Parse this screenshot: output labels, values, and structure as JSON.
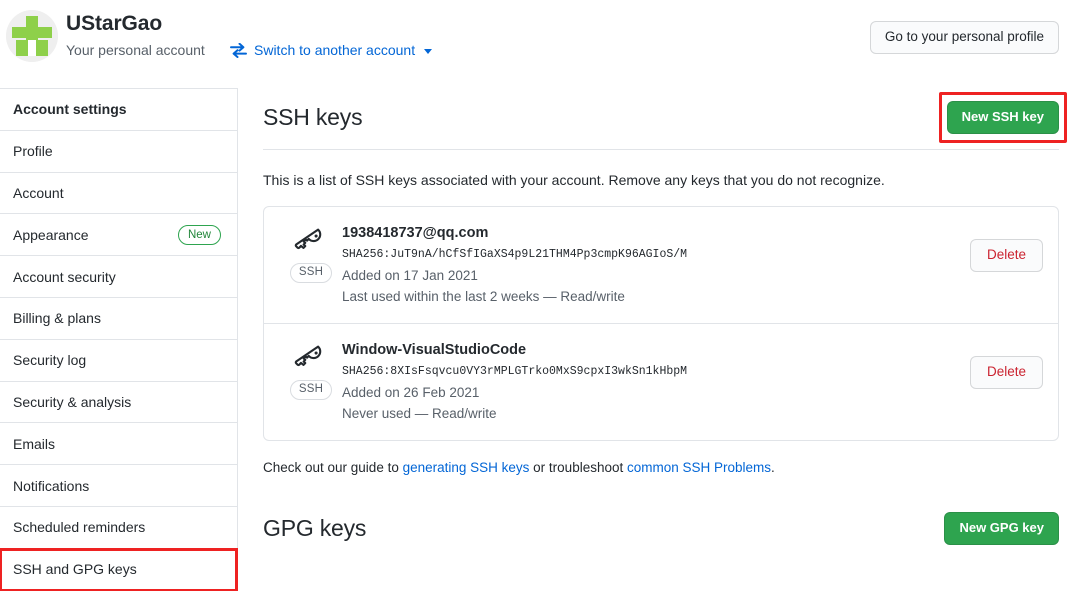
{
  "header": {
    "account_name": "UStarGao",
    "account_subtitle": "Your personal account",
    "switch_label": "Switch to another account",
    "switch_icon": "switch-arrows-icon",
    "personal_profile_button": "Go to your personal profile",
    "avatar_icon": "green-cross-avatar"
  },
  "sidebar": {
    "items": [
      {
        "label": "Account settings",
        "heading": true,
        "badge": "",
        "highlighted": false
      },
      {
        "label": "Profile",
        "heading": false,
        "badge": "",
        "highlighted": false
      },
      {
        "label": "Account",
        "heading": false,
        "badge": "",
        "highlighted": false
      },
      {
        "label": "Appearance",
        "heading": false,
        "badge": "New",
        "highlighted": false
      },
      {
        "label": "Account security",
        "heading": false,
        "badge": "",
        "highlighted": false
      },
      {
        "label": "Billing & plans",
        "heading": false,
        "badge": "",
        "highlighted": false
      },
      {
        "label": "Security log",
        "heading": false,
        "badge": "",
        "highlighted": false
      },
      {
        "label": "Security & analysis",
        "heading": false,
        "badge": "",
        "highlighted": false
      },
      {
        "label": "Emails",
        "heading": false,
        "badge": "",
        "highlighted": false
      },
      {
        "label": "Notifications",
        "heading": false,
        "badge": "",
        "highlighted": false
      },
      {
        "label": "Scheduled reminders",
        "heading": false,
        "badge": "",
        "highlighted": false
      },
      {
        "label": "SSH and GPG keys",
        "heading": false,
        "badge": "",
        "highlighted": true
      }
    ]
  },
  "ssh_section": {
    "title": "SSH keys",
    "new_key_button": "New SSH key",
    "new_key_highlighted": true,
    "description": "This is a list of SSH keys associated with your account. Remove any keys that you do not recognize.",
    "keys": [
      {
        "title": "1938418737@qq.com",
        "fingerprint": "SHA256:JuT9nA/hCfSfIGaXS4p9L21THM4Pp3cmpK96AGIoS/M",
        "added": "Added on 17 Jan 2021",
        "usage": "Last used within the last 2 weeks — Read/write",
        "type_badge": "SSH",
        "delete_label": "Delete"
      },
      {
        "title": "Window-VisualStudioCode",
        "fingerprint": "SHA256:8XIsFsqvcu0VY3rMPLGTrko0MxS9cpxI3wkSn1kHbpM",
        "added": "Added on 26 Feb 2021",
        "usage": "Never used — Read/write",
        "type_badge": "SSH",
        "delete_label": "Delete"
      }
    ],
    "guide": {
      "prefix": "Check out our guide to ",
      "link1": "generating SSH keys",
      "middle": " or troubleshoot ",
      "link2": "common SSH Problems",
      "suffix": "."
    }
  },
  "gpg_section": {
    "title": "GPG keys",
    "new_key_button": "New GPG key"
  },
  "colors": {
    "green_button": "#2ea44f",
    "link_blue": "#0366d6",
    "delete_red": "#cb2431",
    "highlight_red": "#ee2222",
    "border": "#e1e4e8",
    "muted_text": "#586069"
  }
}
